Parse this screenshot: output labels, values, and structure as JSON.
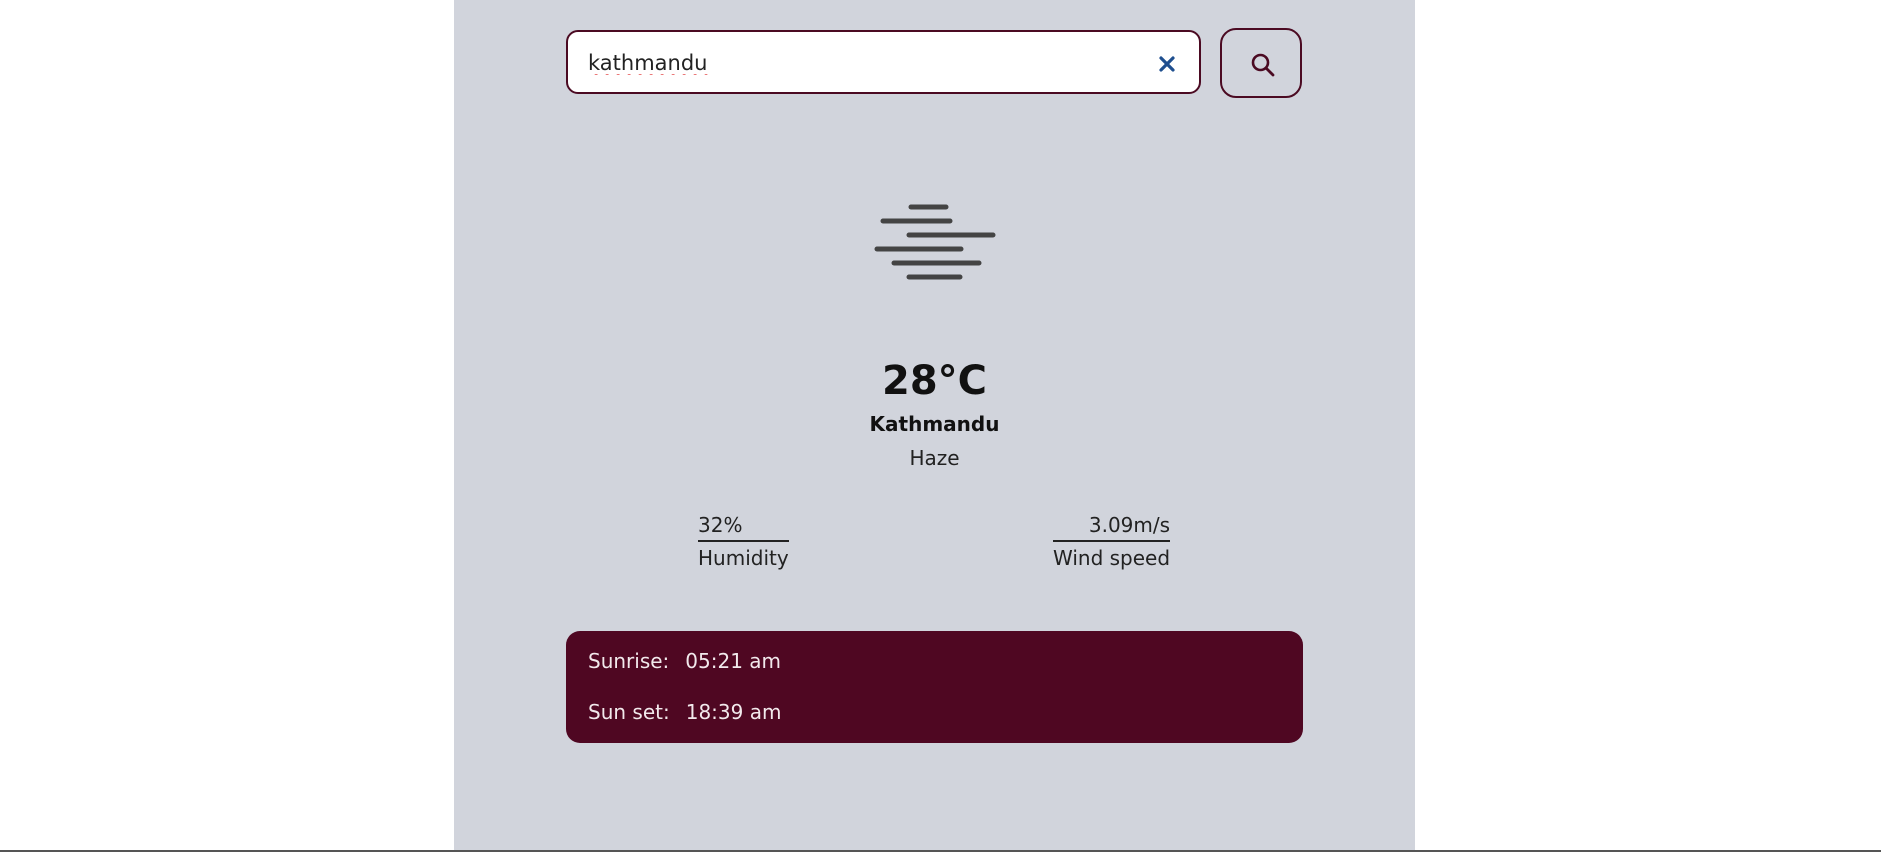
{
  "search": {
    "value": "kathmandu",
    "clear_icon": "close-icon",
    "button_icon": "search-icon"
  },
  "weather": {
    "icon": "haze-icon",
    "temperature": "28°C",
    "city": "Kathmandu",
    "condition": "Haze"
  },
  "stats": {
    "humidity": {
      "value": "32%",
      "label": "Humidity"
    },
    "wind": {
      "value": "3.09m/s",
      "label": "Wind speed"
    }
  },
  "sun": {
    "sunrise_label": "Sunrise:",
    "sunrise_value": "05:21 am",
    "sunset_label": "Sun set:",
    "sunset_value": "18:39 am"
  },
  "colors": {
    "app_background": "#d1d4dc",
    "accent": "#4f0722",
    "clear_icon": "#1f4f8f",
    "icon_gray": "#444444"
  }
}
